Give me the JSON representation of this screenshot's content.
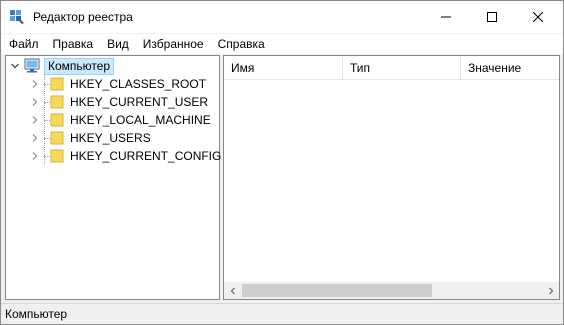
{
  "window": {
    "title": "Редактор реестра",
    "icon": "registry-editor-icon"
  },
  "menu": {
    "items": [
      "Файл",
      "Правка",
      "Вид",
      "Избранное",
      "Справка"
    ]
  },
  "tree": {
    "root_label": "Компьютер",
    "root_icon": "computer-icon",
    "keys": [
      {
        "label": "HKEY_CLASSES_ROOT"
      },
      {
        "label": "HKEY_CURRENT_USER"
      },
      {
        "label": "HKEY_LOCAL_MACHINE"
      },
      {
        "label": "HKEY_USERS"
      },
      {
        "label": "HKEY_CURRENT_CONFIG"
      }
    ]
  },
  "list": {
    "columns": {
      "name": "Имя",
      "type": "Тип",
      "value": "Значение"
    }
  },
  "status": {
    "path": "Компьютер"
  },
  "colors": {
    "selection_bg": "#cce8ff",
    "selection_border": "#99d1ff",
    "folder": "#f5d95a",
    "folder_dark": "#d9b43a"
  }
}
